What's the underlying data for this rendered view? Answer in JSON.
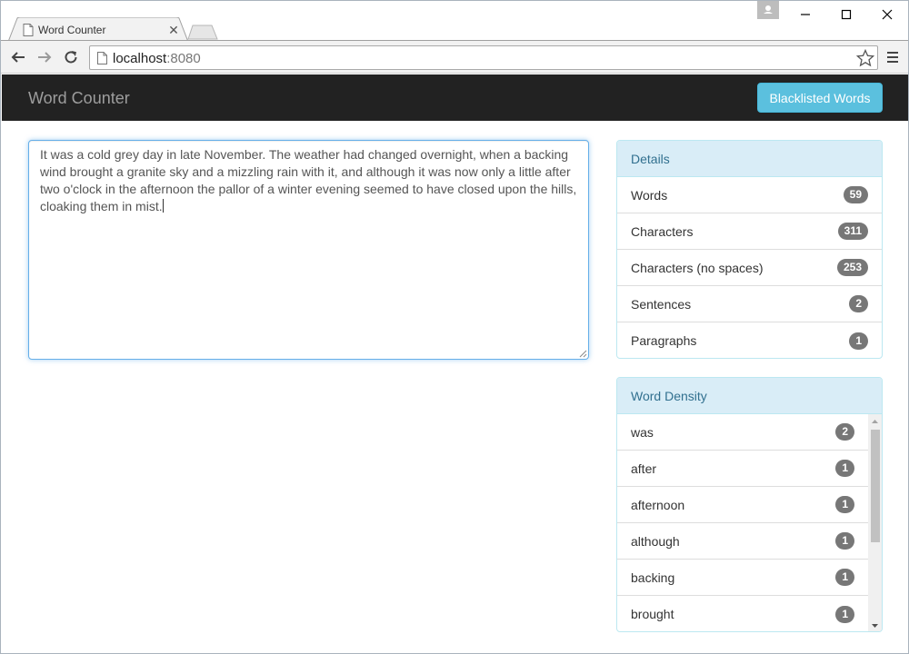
{
  "browser": {
    "tab_title": "Word Counter",
    "tab_close_glyph": "✕",
    "url_host": "localhost",
    "url_port": ":8080"
  },
  "navbar": {
    "brand": "Word Counter",
    "blacklist_button": "Blacklisted Words"
  },
  "editor": {
    "text": "It was a cold grey day in late November. The weather had changed overnight, when a backing wind brought a granite sky and a mizzling rain with it, and although it was now only a little after two o'clock in the afternoon the pallor of a winter evening seemed to have closed upon the hills, cloaking them in mist."
  },
  "details": {
    "heading": "Details",
    "items": [
      {
        "label": "Words",
        "count": "59"
      },
      {
        "label": "Characters",
        "count": "311"
      },
      {
        "label": "Characters (no spaces)",
        "count": "253"
      },
      {
        "label": "Sentences",
        "count": "2"
      },
      {
        "label": "Paragraphs",
        "count": "1"
      }
    ]
  },
  "density": {
    "heading": "Word Density",
    "items": [
      {
        "word": "was",
        "count": "2"
      },
      {
        "word": "after",
        "count": "1"
      },
      {
        "word": "afternoon",
        "count": "1"
      },
      {
        "word": "although",
        "count": "1"
      },
      {
        "word": "backing",
        "count": "1"
      },
      {
        "word": "brought",
        "count": "1"
      }
    ]
  },
  "colors": {
    "navbar_bg": "#222222",
    "brand_text": "#9d9d9d",
    "info_button": "#5bc0de",
    "panel_heading_bg": "#d9edf7",
    "panel_heading_text": "#31708f",
    "badge_bg": "#777777",
    "focus_border": "#66afe9"
  }
}
